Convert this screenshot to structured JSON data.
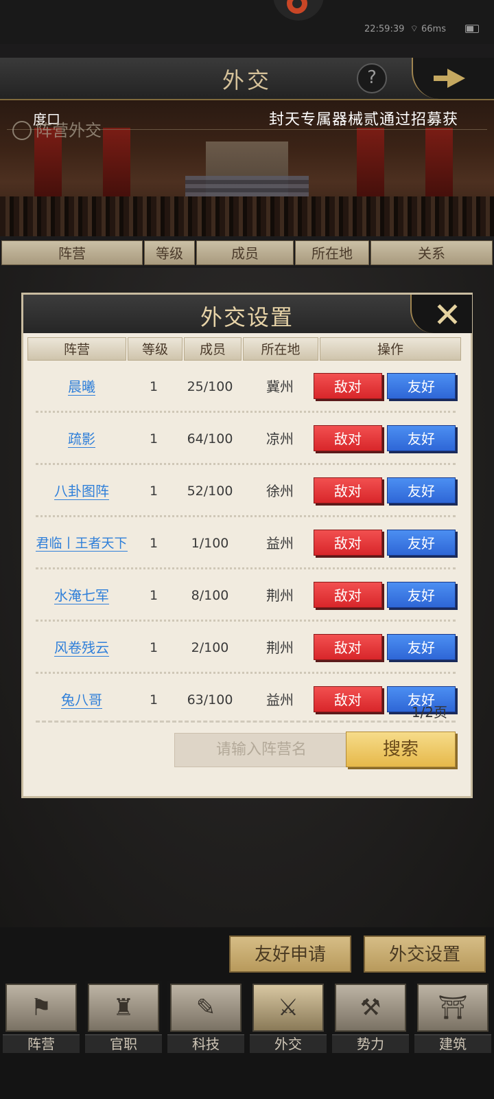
{
  "status": {
    "time": "22:59:39",
    "signal": "66ms"
  },
  "header": {
    "title": "外交",
    "help": "?"
  },
  "banner": {
    "ticker_left": "度口",
    "ticker_right": "封天专属器械贰通过招募获",
    "tab_label": "阵营外交"
  },
  "columns": [
    "阵营",
    "等级",
    "成员",
    "所在地",
    "关系"
  ],
  "dialog": {
    "title": "外交设置",
    "headers": [
      "阵营",
      "等级",
      "成员",
      "所在地",
      "操作"
    ],
    "rows": [
      {
        "name": "晨曦",
        "level": "1",
        "members": "25/100",
        "location": "冀州"
      },
      {
        "name": "疏影",
        "level": "1",
        "members": "64/100",
        "location": "凉州"
      },
      {
        "name": "八卦图阵",
        "level": "1",
        "members": "52/100",
        "location": "徐州"
      },
      {
        "name": "君临丨王者天下",
        "level": "1",
        "members": "1/100",
        "location": "益州"
      },
      {
        "name": "水淹七军",
        "level": "1",
        "members": "8/100",
        "location": "荆州"
      },
      {
        "name": "风卷残云",
        "level": "1",
        "members": "2/100",
        "location": "荆州"
      },
      {
        "name": "兔八哥",
        "level": "1",
        "members": "63/100",
        "location": "益州"
      }
    ],
    "enemy_label": "敌对",
    "friend_label": "友好",
    "pager": "1/2页",
    "search_placeholder": "请输入阵营名",
    "search_button": "搜索"
  },
  "actions": {
    "friend_request": "友好申请",
    "diplomacy_settings": "外交设置"
  },
  "nav": [
    {
      "label": "阵营",
      "icon": "banner-icon"
    },
    {
      "label": "官职",
      "icon": "dragon-seal-icon"
    },
    {
      "label": "科技",
      "icon": "scroll-icon"
    },
    {
      "label": "外交",
      "icon": "crossed-weapons-icon"
    },
    {
      "label": "势力",
      "icon": "battle-axe-icon"
    },
    {
      "label": "建筑",
      "icon": "palace-icon"
    }
  ],
  "colors": {
    "enemy": "#e53b3f",
    "friend": "#3f7fe6",
    "gold": "#e6b84a"
  }
}
